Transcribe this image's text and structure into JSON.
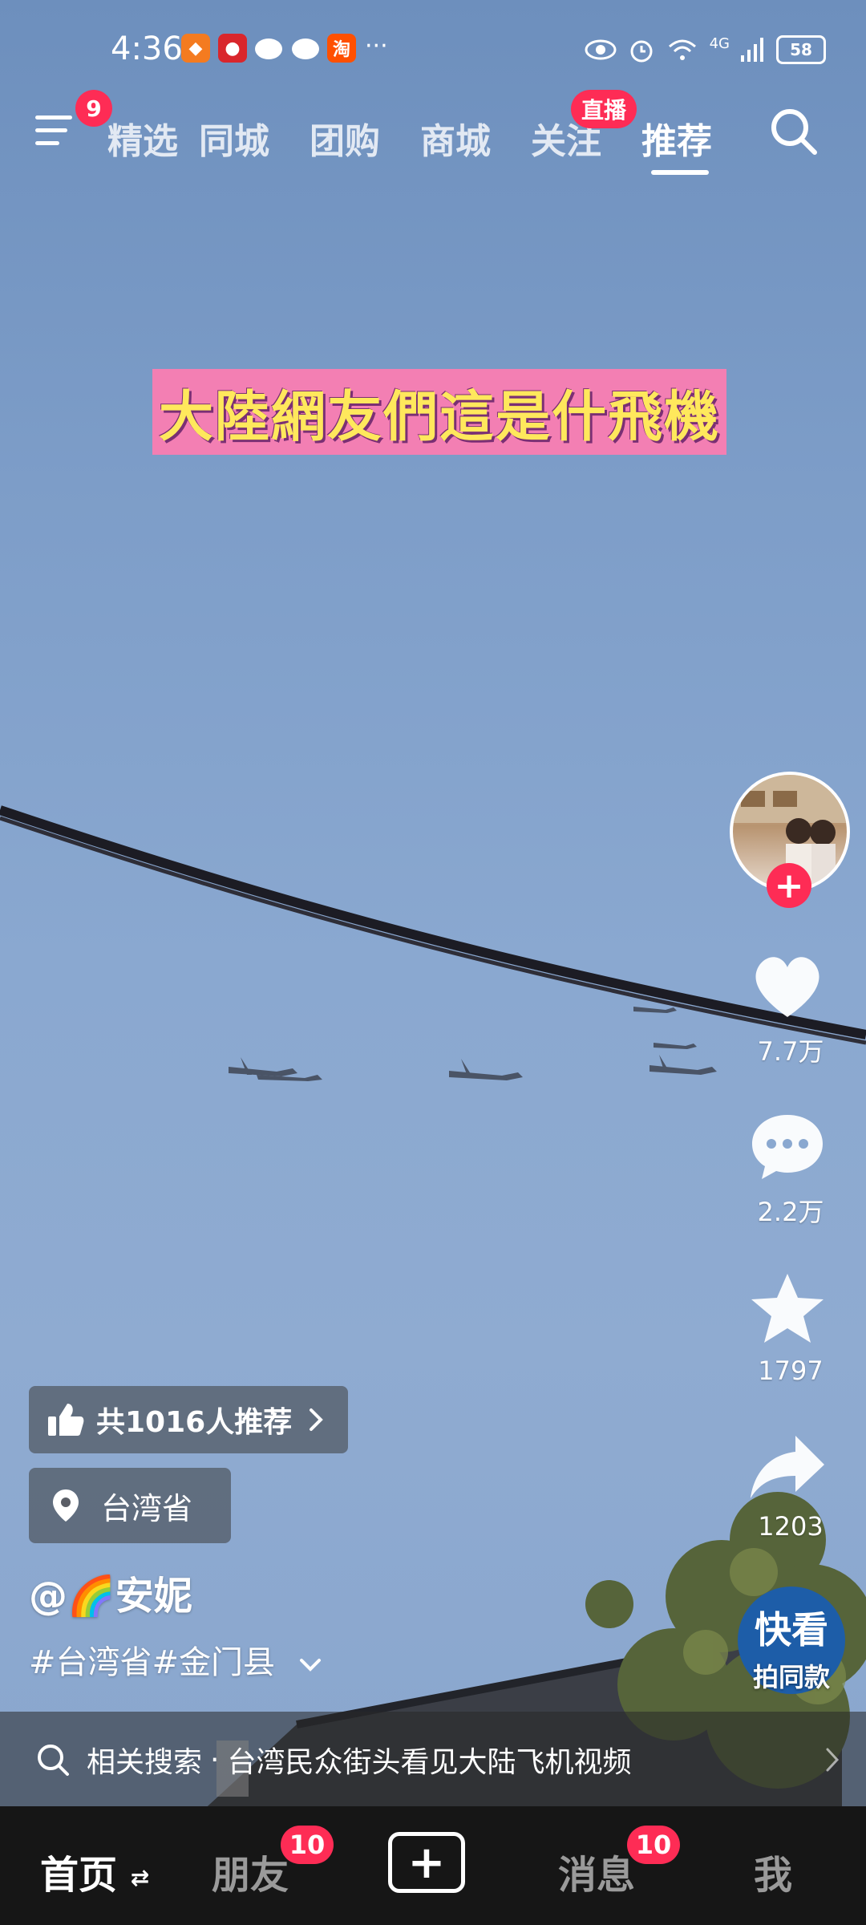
{
  "status_bar": {
    "time": "4:36",
    "network": "4G",
    "battery": "58",
    "more": "···"
  },
  "top_nav": {
    "menu_badge": "9",
    "tabs": [
      "精选",
      "同城",
      "团购",
      "商城",
      "关注",
      "推荐"
    ],
    "active_tab": "推荐",
    "live_badge": "直播"
  },
  "video": {
    "caption": "大陸網友們這是什飛機"
  },
  "right_rail": {
    "likes": "7.7万",
    "comments": "2.2万",
    "favorites": "1797",
    "shares": "1203",
    "kuaikan_title": "快看",
    "kuaikan_sub": "拍同款"
  },
  "info": {
    "recommend": "共1016人推荐",
    "location": "台湾省",
    "author": "@🌈安妮",
    "tags": "#台湾省#金门县"
  },
  "related_search": {
    "label": "相关搜索",
    "separator": "·",
    "query": "台湾民众街头看见大陆飞机视频"
  },
  "bottom_nav": {
    "home": "首页",
    "friends": "朋友",
    "friends_badge": "10",
    "messages": "消息",
    "messages_badge": "10",
    "me": "我"
  },
  "colors": {
    "accent": "#fe2c55",
    "caption_text": "#ffe85c",
    "caption_bg": "#f37fb3"
  }
}
